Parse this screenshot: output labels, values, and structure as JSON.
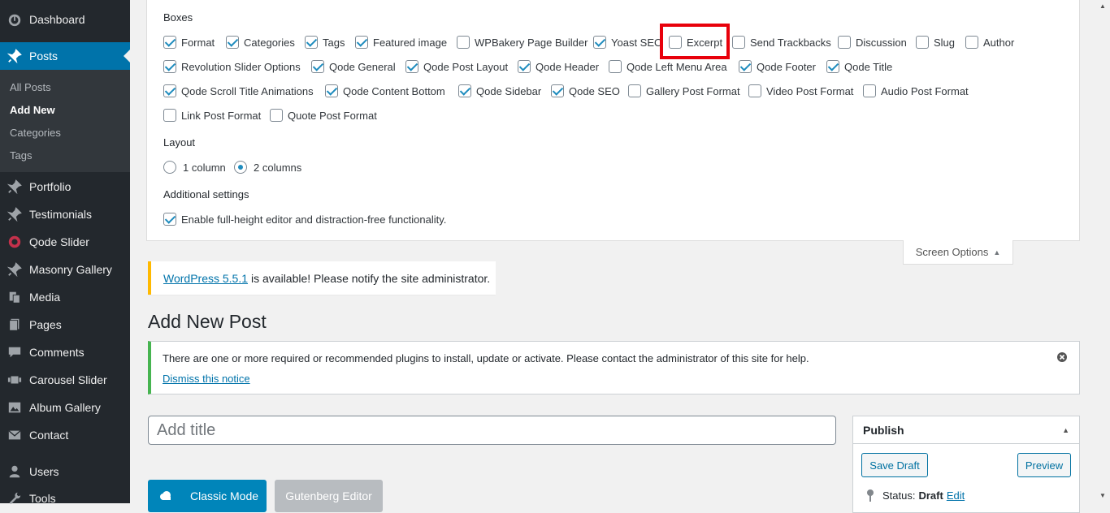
{
  "sidebar": {
    "items": [
      {
        "label": "Dashboard",
        "icon": "dashboard-icon"
      },
      {
        "label": "Posts",
        "icon": "pin-icon"
      },
      {
        "label": "Portfolio",
        "icon": "pin-icon"
      },
      {
        "label": "Testimonials",
        "icon": "pin-icon"
      },
      {
        "label": "Qode Slider",
        "icon": "slider-icon"
      },
      {
        "label": "Masonry Gallery",
        "icon": "pin-icon"
      },
      {
        "label": "Media",
        "icon": "media-icon"
      },
      {
        "label": "Pages",
        "icon": "pages-icon"
      },
      {
        "label": "Comments",
        "icon": "comments-icon"
      },
      {
        "label": "Carousel Slider",
        "icon": "carousel-icon"
      },
      {
        "label": "Album Gallery",
        "icon": "gallery-icon"
      },
      {
        "label": "Contact",
        "icon": "mail-icon"
      },
      {
        "label": "Users",
        "icon": "users-icon"
      },
      {
        "label": "Tools",
        "icon": "tools-icon"
      }
    ],
    "submenu": [
      "All Posts",
      "Add New",
      "Categories",
      "Tags"
    ]
  },
  "screen_options": {
    "boxes_heading": "Boxes",
    "boxes": [
      {
        "label": "Format",
        "checked": true
      },
      {
        "label": "Categories",
        "checked": true
      },
      {
        "label": "Tags",
        "checked": true
      },
      {
        "label": "Featured image",
        "checked": true
      },
      {
        "label": "WPBakery Page Builder",
        "checked": false
      },
      {
        "label": "Yoast SEO",
        "checked": true
      },
      {
        "label": "Excerpt",
        "checked": false
      },
      {
        "label": "Send Trackbacks",
        "checked": false
      },
      {
        "label": "Discussion",
        "checked": false
      },
      {
        "label": "Slug",
        "checked": false
      },
      {
        "label": "Author",
        "checked": false
      },
      {
        "label": "Revolution Slider Options",
        "checked": true
      },
      {
        "label": "Qode General",
        "checked": true
      },
      {
        "label": "Qode Post Layout",
        "checked": true
      },
      {
        "label": "Qode Header",
        "checked": true
      },
      {
        "label": "Qode Left Menu Area",
        "checked": false
      },
      {
        "label": "Qode Footer",
        "checked": true
      },
      {
        "label": "Qode Title",
        "checked": true
      },
      {
        "label": "Qode Scroll Title Animations",
        "checked": true
      },
      {
        "label": "Qode Content Bottom",
        "checked": true
      },
      {
        "label": "Qode Sidebar",
        "checked": true
      },
      {
        "label": "Qode SEO",
        "checked": true
      },
      {
        "label": "Gallery Post Format",
        "checked": false
      },
      {
        "label": "Video Post Format",
        "checked": false
      },
      {
        "label": "Audio Post Format",
        "checked": false
      },
      {
        "label": "Link Post Format",
        "checked": false
      },
      {
        "label": "Quote Post Format",
        "checked": false
      }
    ],
    "layout_heading": "Layout",
    "layout_options": [
      {
        "label": "1 column",
        "checked": false
      },
      {
        "label": "2 columns",
        "checked": true
      }
    ],
    "additional_heading": "Additional settings",
    "additional_option": {
      "label": "Enable full-height editor and distraction-free functionality.",
      "checked": true
    },
    "tab_label": "Screen Options"
  },
  "update_nag": {
    "link": "WordPress 5.5.1",
    "text": "is available! Please notify the site administrator."
  },
  "page_title": "Add New Post",
  "notice": {
    "message": "There are one or more required or recommended plugins to install, update or activate. Please contact the administrator of this site for help.",
    "dismiss": "Dismiss this notice"
  },
  "title_input": {
    "placeholder": "Add title",
    "value": ""
  },
  "editor_buttons": {
    "classic": "Classic Mode",
    "gutenberg": "Gutenberg Editor"
  },
  "publish": {
    "heading": "Publish",
    "save_draft": "Save Draft",
    "preview": "Preview",
    "status_label": "Status:",
    "status_value": "Draft",
    "status_edit": "Edit"
  },
  "colors": {
    "sidebar_bg": "#23282d",
    "active_menu": "#0073aa",
    "highlight": "#e8000b",
    "notice_success": "#46b450",
    "notice_warning": "#ffb900"
  }
}
